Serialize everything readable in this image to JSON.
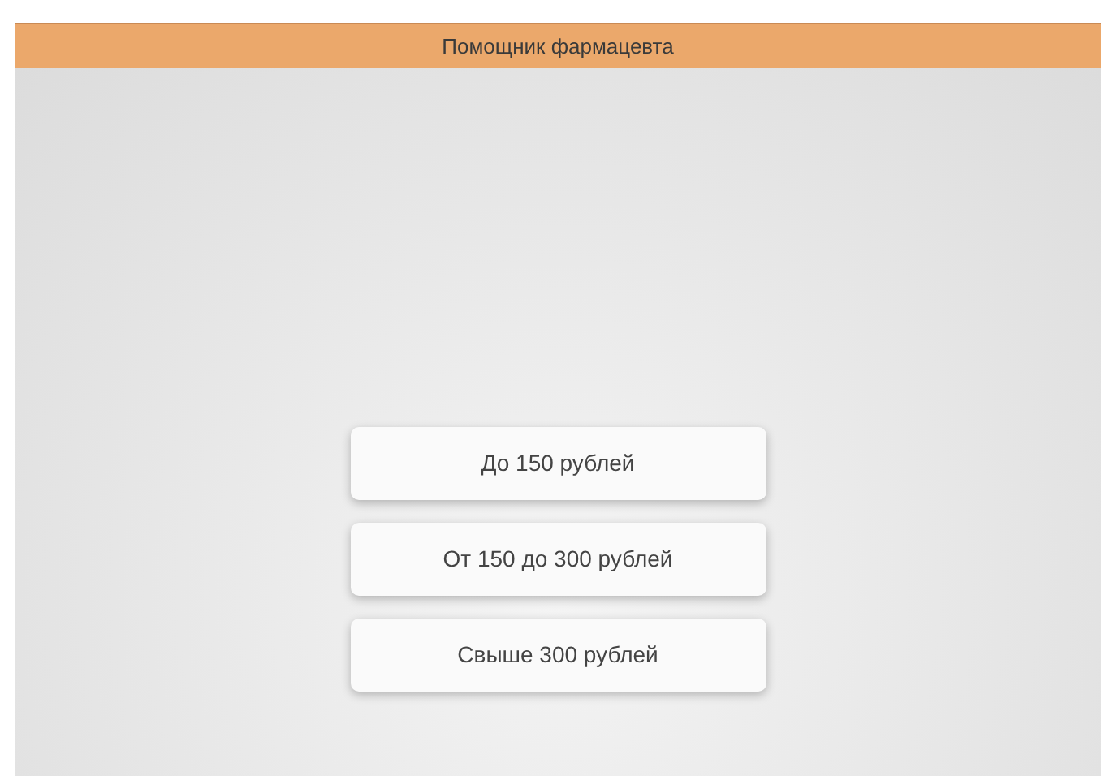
{
  "window": {
    "title": "Помощник фармацевта"
  },
  "options": [
    {
      "label": "До 150 рублей"
    },
    {
      "label": "От 150 до 300 рублей"
    },
    {
      "label": "Свыше 300 рублей"
    }
  ]
}
